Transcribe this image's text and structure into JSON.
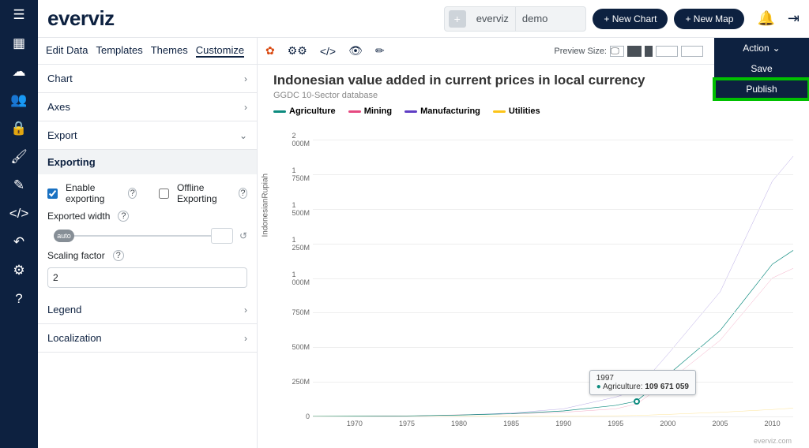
{
  "logo": "everviz",
  "tags": {
    "a": "everviz",
    "b": "demo"
  },
  "buttons": {
    "newChart": "+ New Chart",
    "newMap": "+ New Map"
  },
  "tabs": [
    "Edit Data",
    "Templates",
    "Themes",
    "Customize"
  ],
  "activeTab": 3,
  "accordion": {
    "chart": "Chart",
    "axes": "Axes",
    "export": "Export",
    "exporting": "Exporting",
    "enableExporting": "Enable exporting",
    "offlineExporting": "Offline Exporting",
    "exportedWidth": "Exported width",
    "auto": "auto",
    "scalingFactor": "Scaling factor",
    "scaleVal": "2",
    "legend": "Legend",
    "localization": "Localization"
  },
  "previewSize": "Preview Size:",
  "actionMenu": {
    "title": "Action",
    "save": "Save",
    "publish": "Publish"
  },
  "chart": {
    "title": "Indonesian value added in current prices in local currency",
    "subtitle": "GGDC 10-Sector database",
    "ylabel": "IndonesianRupiah",
    "credit": "everviz.com",
    "tooltip": {
      "year": "1997",
      "series": "Agriculture:",
      "value": "109 671 059"
    }
  },
  "chart_data": {
    "type": "line",
    "xlabel": "",
    "ylabel": "IndonesianRupiah",
    "ylim": [
      0,
      2000
    ],
    "yunit": "M",
    "xticks": [
      1970,
      1975,
      1980,
      1985,
      1990,
      1995,
      2000,
      2005,
      2010
    ],
    "yticks": [
      0,
      "250M",
      "500M",
      "750M",
      "1 000M",
      "1 250M",
      "1 500M",
      "1 750M",
      "2 000M"
    ],
    "series": [
      {
        "name": "Agriculture",
        "color": "#0d8b7f",
        "values": {
          "1966": 1,
          "1970": 2,
          "1975": 4,
          "1980": 10,
          "1985": 20,
          "1990": 40,
          "1995": 80,
          "1997": 110,
          "2000": 300,
          "2005": 620,
          "2010": 1100,
          "2012": 1200
        }
      },
      {
        "name": "Mining",
        "color": "#e64980",
        "values": {
          "1966": 0,
          "1970": 1,
          "1975": 3,
          "1980": 12,
          "1985": 18,
          "1990": 30,
          "1995": 55,
          "1997": 90,
          "2000": 250,
          "2005": 550,
          "2010": 1000,
          "2012": 1070
        }
      },
      {
        "name": "Manufacturing",
        "color": "#5f3dc4",
        "values": {
          "1966": 0,
          "1970": 1,
          "1975": 3,
          "1980": 10,
          "1985": 25,
          "1990": 55,
          "1995": 140,
          "1997": 190,
          "2000": 450,
          "2005": 900,
          "2010": 1700,
          "2012": 1880
        }
      },
      {
        "name": "Utilities",
        "color": "#fcc419",
        "values": {
          "1966": 0,
          "1970": 0,
          "1975": 0,
          "1980": 1,
          "1985": 2,
          "1990": 3,
          "1995": 5,
          "1997": 7,
          "2000": 15,
          "2005": 30,
          "2010": 50,
          "2012": 60
        }
      }
    ],
    "xrange": [
      1966,
      2012
    ]
  }
}
